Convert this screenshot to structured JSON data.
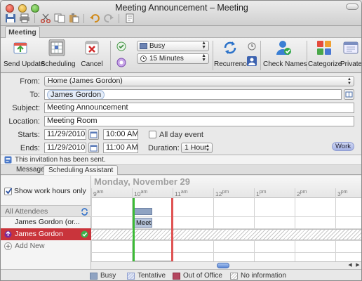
{
  "window": {
    "title": "Meeting Announcement – Meeting"
  },
  "ribbon": {
    "tab": "Meeting",
    "send_update": "Send Update",
    "scheduling": "Scheduling",
    "cancel": "Cancel",
    "show_as": "Busy",
    "reminder": "15 Minutes",
    "recurrence": "Recurrence",
    "check_names": "Check Names",
    "categorize": "Categorize",
    "private": "Private"
  },
  "form": {
    "from_label": "From:",
    "from_value": "Home (James Gordon)",
    "to_label": "To:",
    "to_value": "James Gordon",
    "subject_label": "Subject:",
    "subject_value": "Meeting Announcement",
    "location_label": "Location:",
    "location_value": "Meeting Room",
    "starts_label": "Starts:",
    "start_date": "11/29/2010",
    "start_time": "10:00 AM",
    "all_day_label": "All day event",
    "ends_label": "Ends:",
    "end_date": "11/29/2010",
    "end_time": "11:00 AM",
    "duration_label": "Duration:",
    "duration_value": "1 Hour",
    "work_badge": "Work"
  },
  "info_bar": {
    "message": "This invitation has been sent."
  },
  "sub_tabs": {
    "message": "Message",
    "scheduling_assistant": "Scheduling Assistant"
  },
  "scheduling": {
    "show_work_hours": "Show work hours only",
    "all_attendees": "All Attendees",
    "attendees": [
      {
        "name": "James Gordon (or..."
      },
      {
        "name": "James Gordon"
      }
    ],
    "add_new": "Add New",
    "day_title": "Monday, November 29",
    "hours": [
      "9",
      "10",
      "11",
      "12",
      "1",
      "2",
      "3"
    ],
    "hour_suffix": [
      "am",
      "am",
      "am",
      "pm",
      "pm",
      "pm",
      "pm"
    ],
    "meeting_block_label": "Meetin"
  },
  "legend": {
    "busy": "Busy",
    "tentative": "Tentative",
    "out_of_office": "Out of Office",
    "no_information": "No information"
  },
  "colors": {
    "busy": "#8fa3c2",
    "tentative": "#c9d3ea",
    "out_of_office": "#b4465f",
    "start_marker": "#3cbb36",
    "end_marker": "#e05353",
    "selected_attendee": "#c9343b"
  }
}
